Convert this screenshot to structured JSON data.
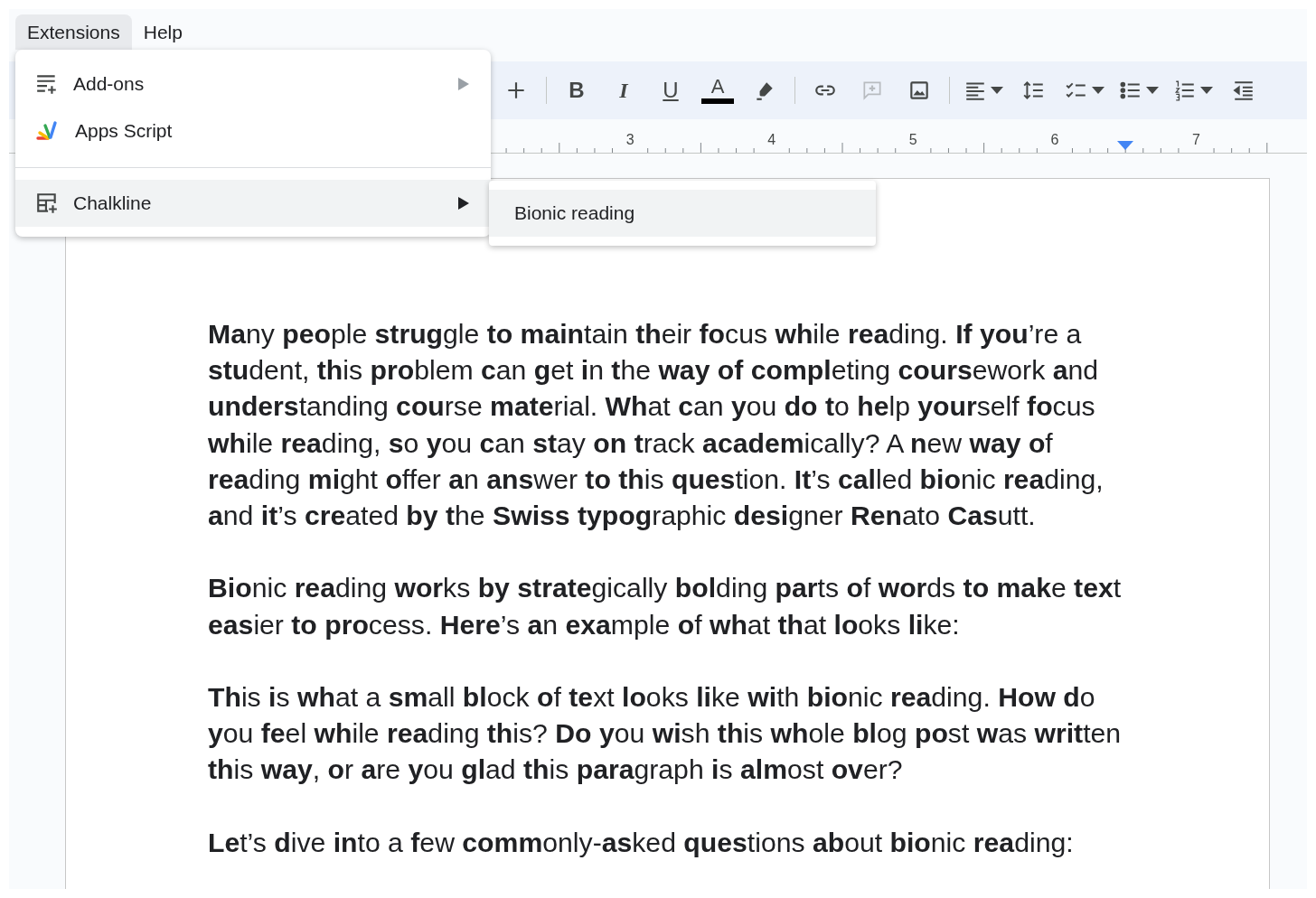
{
  "menu_bar": [
    {
      "label": "Extensions",
      "selected": true
    },
    {
      "label": "Help",
      "selected": false
    }
  ],
  "extensions_menu": {
    "items": [
      {
        "kind": "addons",
        "label": "Add-ons",
        "has_submenu": true,
        "selected": false,
        "separator_before": false
      },
      {
        "kind": "script",
        "label": "Apps Script",
        "has_submenu": false,
        "selected": false,
        "separator_before": false
      },
      {
        "kind": "table",
        "label": "Chalkline",
        "has_submenu": true,
        "selected": true,
        "separator_before": true
      }
    ]
  },
  "submenu": {
    "items": [
      {
        "label": "Bionic reading",
        "selected": true
      }
    ]
  },
  "toolbar": {
    "items": [
      {
        "kind": "plus",
        "dropdown": false,
        "disabled": false
      },
      {
        "kind": "separator"
      },
      {
        "kind": "bold",
        "label": "B",
        "dropdown": false,
        "disabled": false
      },
      {
        "kind": "italic",
        "label": "I",
        "dropdown": false,
        "disabled": false
      },
      {
        "kind": "underline",
        "label": "U",
        "dropdown": false,
        "disabled": false
      },
      {
        "kind": "textcolor",
        "label": "A",
        "dropdown": false,
        "disabled": false
      },
      {
        "kind": "highlight",
        "dropdown": false,
        "disabled": false
      },
      {
        "kind": "separator"
      },
      {
        "kind": "link",
        "dropdown": false,
        "disabled": false
      },
      {
        "kind": "comment",
        "dropdown": false,
        "disabled": true
      },
      {
        "kind": "image",
        "dropdown": false,
        "disabled": false
      },
      {
        "kind": "separator"
      },
      {
        "kind": "align",
        "dropdown": true,
        "disabled": false
      },
      {
        "kind": "spacing",
        "dropdown": false,
        "disabled": false
      },
      {
        "kind": "checklist",
        "dropdown": true,
        "disabled": false
      },
      {
        "kind": "bullets",
        "dropdown": true,
        "disabled": false
      },
      {
        "kind": "numbered",
        "dropdown": true,
        "disabled": false
      },
      {
        "kind": "outdent",
        "dropdown": false,
        "disabled": false
      }
    ]
  },
  "ruler": {
    "numbers": [
      "3",
      "4",
      "5",
      "6",
      "7"
    ]
  },
  "document": {
    "paragraphs": [
      "**Ma**ny **peo**ple **strug**gle **to** **main**tain **th**eir **fo**cus **wh**ile **rea**ding. **If** **you**’re a **stu**dent, **th**is **pro**blem **c**an **g**et **i**n **t**he **way** **of** **compl**eting **cours**ework **a**nd **unders**tanding **cou**rse **mate**rial. **Wh**at **c**an **y**ou **do** **t**o **he**lp **your**self **fo**cus **wh**ile **rea**ding, **s**o **y**ou **c**an **st**ay **on** **t**rack **academ**ically? A **n**ew **way** **o**f **rea**ding **mi**ght **o**ffer **a**n **ans**wer **to** **th**is **ques**tion. **It**’s **cal**led **bio**nic **rea**ding, **a**nd **it**’s **cre**ated **by** **t**he **Swiss** **typog**raphic **desi**gner **Ren**ato **Cas**utt.",
      "**Bio**nic **rea**ding **wor**ks **by** **strate**gically **bol**ding **par**ts **o**f **wor**ds **to** **mak**e **tex**t **eas**ier **to** **pro**cess. **Here**’s **a**n **exa**mple **o**f **wh**at **th**at **lo**oks **li**ke:",
      "**Th**is **i**s **wh**at a **sm**all **bl**ock **o**f **te**xt **lo**oks **li**ke **wi**th **bio**nic **rea**ding. **How** **d**o **y**ou **fe**el **wh**ile **rea**ding **th**is? **Do** **y**ou **wi**sh **th**is **wh**ole **bl**og **po**st **w**as **writ**ten **th**is **way**, **o**r **a**re **y**ou **gl**ad **th**is **para**graph **i**s **alm**ost **ov**er?",
      "**Le**t’s **d**ive **in**to a **f**ew **comm**only-**as**ked **ques**tions **ab**out **bio**nic **rea**ding:"
    ]
  }
}
